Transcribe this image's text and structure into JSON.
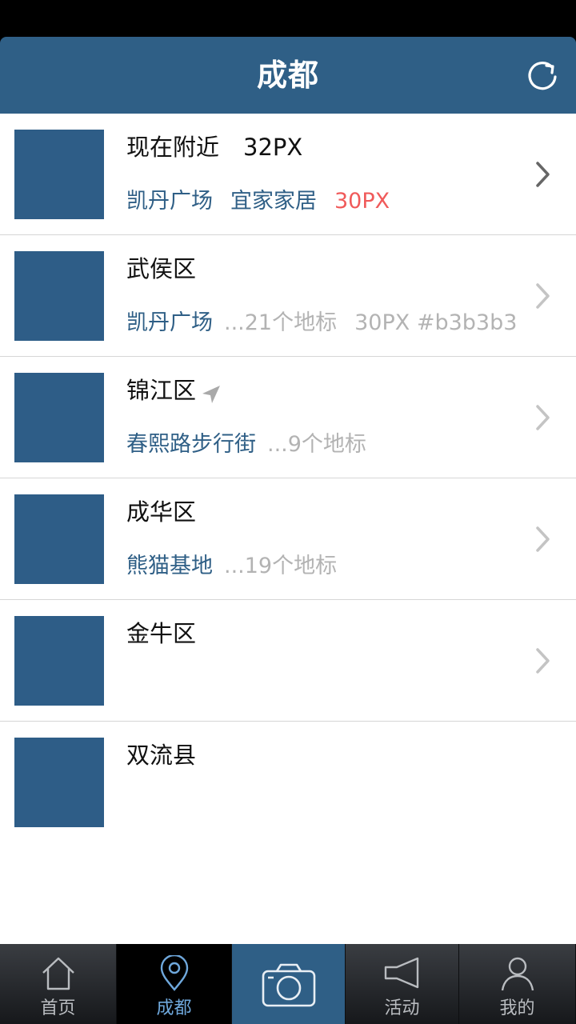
{
  "header": {
    "title": "成都",
    "refresh_icon": "refresh-icon"
  },
  "colors": {
    "accent": "#2f5f86",
    "red_note": "#f05a5a",
    "gray_note": "#b3b3b3"
  },
  "rows": [
    {
      "title": "现在附近",
      "title_note": "32PX",
      "landmarks": [
        "凯丹广场",
        "宜家家居"
      ],
      "count": "",
      "note": "30PX",
      "note_color": "red",
      "location_icon": false,
      "chevron": true
    },
    {
      "title": "武侯区",
      "title_note": "",
      "landmarks": [
        "凯丹广场"
      ],
      "count": "...21个地标",
      "note": "30PX #b3b3b3",
      "note_color": "gray",
      "location_icon": false,
      "chevron": true
    },
    {
      "title": "锦江区",
      "title_note": "",
      "landmarks": [
        "春熙路步行街"
      ],
      "count": "...9个地标",
      "note": "",
      "note_color": "",
      "location_icon": true,
      "chevron": true
    },
    {
      "title": "成华区",
      "title_note": "",
      "landmarks": [
        "熊猫基地"
      ],
      "count": "...19个地标",
      "note": "",
      "note_color": "",
      "location_icon": false,
      "chevron": true
    },
    {
      "title": "金牛区",
      "title_note": "",
      "landmarks": [],
      "count": "",
      "note": "",
      "note_color": "",
      "location_icon": false,
      "chevron": true
    },
    {
      "title": "双流县",
      "title_note": "",
      "landmarks": [],
      "count": "",
      "note": "",
      "note_color": "",
      "location_icon": false,
      "chevron": false
    }
  ],
  "tabs": [
    {
      "label": "首页",
      "icon": "home-icon",
      "active": false
    },
    {
      "label": "成都",
      "icon": "location-pin-icon",
      "active": true
    },
    {
      "label": "",
      "icon": "camera-icon",
      "active": false
    },
    {
      "label": "活动",
      "icon": "megaphone-icon",
      "active": false
    },
    {
      "label": "我的",
      "icon": "user-icon",
      "active": false
    }
  ]
}
